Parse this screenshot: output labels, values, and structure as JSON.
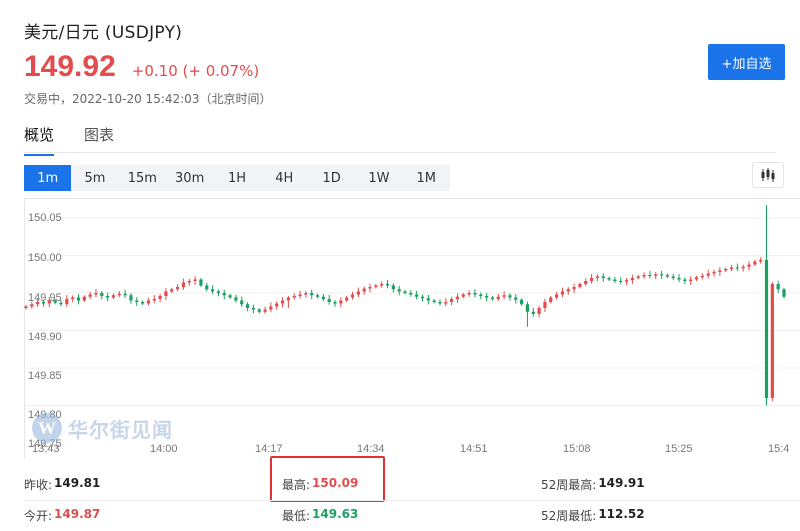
{
  "header": {
    "title": "美元/日元  (USDJPY)",
    "price": "149.92",
    "change": "+0.10 (+ 0.07%)",
    "status": "交易中，2022-10-20 15:42:03（北京时间）",
    "add_button": "+加自选"
  },
  "tabs": [
    {
      "label": "概览",
      "active": true
    },
    {
      "label": "图表",
      "active": false
    }
  ],
  "periods": [
    "1m",
    "5m",
    "15m",
    "30m",
    "1H",
    "4H",
    "1D",
    "1W",
    "1M"
  ],
  "active_period": "1m",
  "colors": {
    "up": "#e24c4c",
    "down": "#19a15f",
    "accent": "#1a73e8"
  },
  "chart_data": {
    "type": "candlestick",
    "y_ticks": [
      "150.05",
      "150.00",
      "149.95",
      "149.90",
      "149.85",
      "149.80",
      "149.75"
    ],
    "x_ticks": [
      "13:43",
      "14:00",
      "14:17",
      "14:34",
      "14:51",
      "15:08",
      "15:25",
      "15:4"
    ],
    "ylim": [
      149.75,
      150.06
    ],
    "closes": [
      149.932,
      149.935,
      149.938,
      149.936,
      149.94,
      149.937,
      149.935,
      149.942,
      149.944,
      149.94,
      149.945,
      149.948,
      149.95,
      149.946,
      149.944,
      149.947,
      149.949,
      149.947,
      149.94,
      149.938,
      149.936,
      149.94,
      149.942,
      149.946,
      149.952,
      149.955,
      149.958,
      149.964,
      149.966,
      149.968,
      149.96,
      149.955,
      149.952,
      149.95,
      149.947,
      149.944,
      149.94,
      149.935,
      149.93,
      149.928,
      149.925,
      149.928,
      149.932,
      149.936,
      149.94,
      149.944,
      149.946,
      149.948,
      149.95,
      149.947,
      149.945,
      149.942,
      149.938,
      149.936,
      149.94,
      149.944,
      149.948,
      149.952,
      149.956,
      149.958,
      149.96,
      149.962,
      149.96,
      149.955,
      149.952,
      149.95,
      149.948,
      149.945,
      149.943,
      149.94,
      149.938,
      149.936,
      149.938,
      149.942,
      149.945,
      149.948,
      149.95,
      149.948,
      149.946,
      149.944,
      149.942,
      149.945,
      149.947,
      149.944,
      149.941,
      149.935,
      149.925,
      149.922,
      149.93,
      149.938,
      149.944,
      149.948,
      149.952,
      149.955,
      149.958,
      149.962,
      149.966,
      149.97,
      149.972,
      149.97,
      149.968,
      149.966,
      149.965,
      149.967,
      149.97,
      149.972,
      149.974,
      149.973,
      149.975,
      149.974,
      149.972,
      149.97,
      149.968,
      149.966,
      149.968,
      149.971,
      149.973,
      149.976,
      149.978,
      149.98,
      149.982,
      149.984,
      149.983,
      149.985,
      149.988,
      149.992,
      149.994,
      149.81,
      149.962,
      149.955,
      149.945
    ],
    "day_high": "150.09",
    "day_low": "149.63"
  },
  "watermark": {
    "mark": "W",
    "text": "华尔街见闻"
  },
  "stats": {
    "prev_close": {
      "label": "昨收:",
      "value": "149.81"
    },
    "open": {
      "label": "今开:",
      "value": "149.87"
    },
    "high": {
      "label": "最高:",
      "value": "150.09"
    },
    "low": {
      "label": "最低:",
      "value": "149.63"
    },
    "w52_high": {
      "label": "52周最高:",
      "value": "149.91"
    },
    "w52_low": {
      "label": "52周最低:",
      "value": "112.52"
    }
  }
}
